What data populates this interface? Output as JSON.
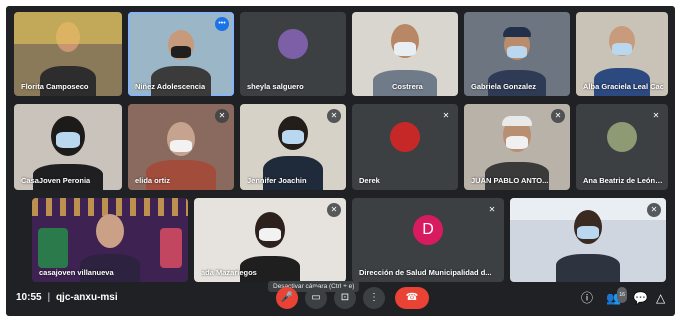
{
  "participants": [
    {
      "name": "Florita Camposeco",
      "muted": false
    },
    {
      "name": "Niñez Adolescencia",
      "muted": false
    },
    {
      "name": "sheyla salguero",
      "muted": false
    },
    {
      "name": "Costrera",
      "muted": false
    },
    {
      "name": "Gabriela Gonzalez",
      "muted": false
    },
    {
      "name": "Alba Graciela Leal Cac",
      "muted": false
    },
    {
      "name": "CasaJoven Peronia",
      "muted": false
    },
    {
      "name": "elida ortiz",
      "muted": true
    },
    {
      "name": "Jennifer Joachin",
      "muted": true
    },
    {
      "name": "Derek",
      "muted": true
    },
    {
      "name": "JUAN PABLO ANTO...",
      "muted": true
    },
    {
      "name": "Ana Beatriz de León Dí...",
      "muted": true
    },
    {
      "name": "casajoven villanueva",
      "muted": false
    },
    {
      "name": "ada Mazariegos",
      "muted": true
    },
    {
      "name": "Dirección de Salud Municipalidad d...",
      "muted": true,
      "initial": "D"
    },
    {
      "name": "",
      "muted": true
    }
  ],
  "bottom_bar": {
    "time": "10:55",
    "separator": "|",
    "meeting_code": "qjc-anxu-msi",
    "tooltip": "Desactivar cámara (Ctrl + e)",
    "people_count": "16"
  },
  "colors": {
    "mic_off_button": "#ea4335",
    "end_call": "#ea4335",
    "avatar_d": "#d81b60",
    "background": "#202124"
  },
  "icons": [
    "mic-off-icon",
    "camera-icon",
    "present-icon",
    "more-icon",
    "end-call-icon",
    "info-icon",
    "people-icon",
    "chat-icon",
    "activities-icon"
  ]
}
